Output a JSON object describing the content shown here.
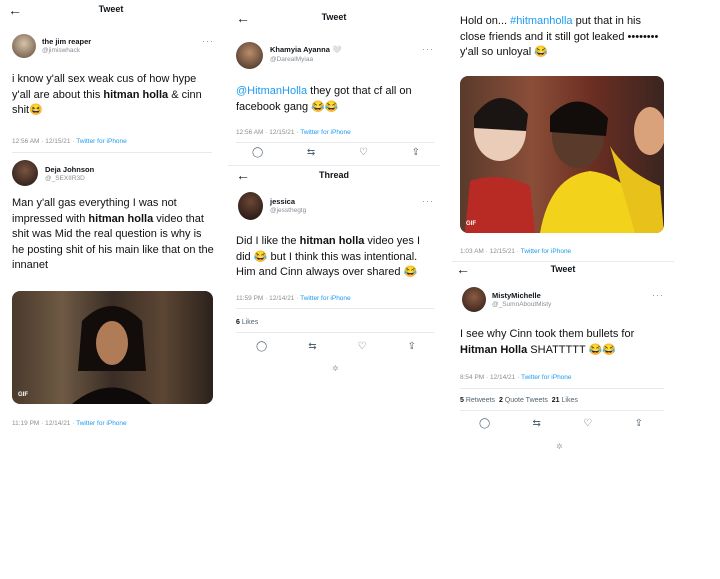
{
  "col1": {
    "header_title": "Tweet",
    "tweet1": {
      "name": "the jim reaper",
      "handle": "@jimiswhack",
      "text_pre": "i know y'all sex weak cus of how hype y'all are about this ",
      "text_bold": "hitman holla",
      "text_post": " & cinn shit😆",
      "time": "12:56 AM · 12/15/21 · ",
      "source": "Twitter for iPhone"
    },
    "tweet2": {
      "name": "Deja Johnson",
      "handle": "@_SEXIIR3D",
      "text_pre": "Man y'all gas everything I was not impressed with ",
      "text_bold": "hitman holla",
      "text_post": " video that shit was Mid the real question is why is he posting shit of his main like that on the innanet",
      "gif_label": "GIF",
      "time": "11:19 PM · 12/14/21 · ",
      "source": "Twitter for iPhone"
    }
  },
  "col2": {
    "header_title": "Tweet",
    "tweet1": {
      "name": "Khamyia Ayanna 🤍",
      "handle": "@DarealMyiaa",
      "mention": "@HitmanHolla",
      "text": " they got that cf all on facebook gang 😂😂",
      "time": "12:56 AM · 12/15/21 · ",
      "source": "Twitter for iPhone"
    },
    "thread_title": "Thread",
    "tweet2": {
      "name": "jessica",
      "handle": "@jessthegtg",
      "text_pre": "Did I like the ",
      "text_bold": "hitman holla",
      "text_post": " video yes I did 😂 but I think this was intentional. Him and Cinn always over shared 😂",
      "time": "11:59 PM · 12/14/21 · ",
      "source": "Twitter for iPhone",
      "likes_count": "6",
      "likes_label": "Likes"
    }
  },
  "col3": {
    "tweet1": {
      "text_pre": "Hold on... ",
      "hashtag": "#hitmanholla",
      "text_post": " put that in his close friends and it still got leaked •••••••• y'all so unloyal 😂",
      "gif_label": "GIF",
      "time": "1:03 AM · 12/15/21 · ",
      "source": "Twitter for iPhone"
    },
    "header_title": "Tweet",
    "tweet2": {
      "name": "MistyMichelle",
      "handle": "@_SumnAboutMisty",
      "text_pre": "I see why Cinn took them bullets for ",
      "text_bold": "Hitman Holla",
      "text_post": " SHATTTTT 😂😂",
      "time": "8:54 PM · 12/14/21 · ",
      "source": "Twitter for iPhone",
      "retweets_count": "5",
      "retweets_label": "Retweets",
      "quotes_count": "2",
      "quotes_label": "Quote Tweets",
      "likes_count": "21",
      "likes_label": "Likes"
    }
  },
  "icons": {
    "back": "←",
    "more": "···",
    "reply": "◯",
    "retweet": "⇆",
    "like": "♡",
    "share": "⇪",
    "spinner": "✲"
  },
  "colors": {
    "link": "#1d9bf0",
    "muted": "#8a8f95",
    "divider": "#e7e9ea"
  }
}
